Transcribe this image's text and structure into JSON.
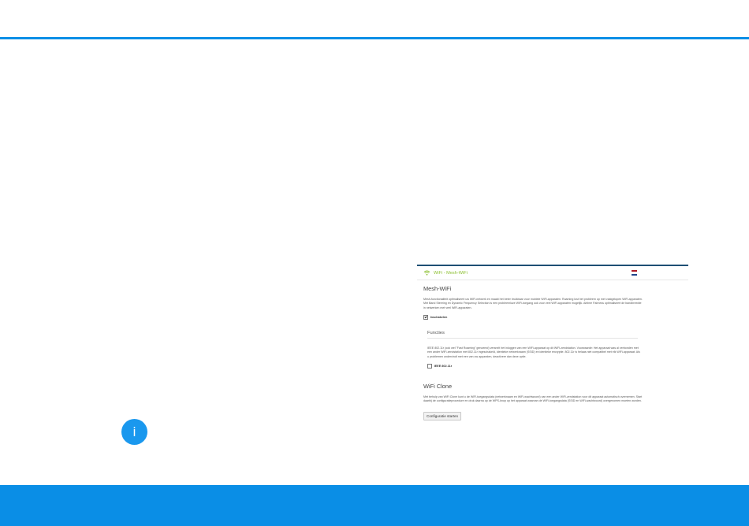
{
  "info_badge": {
    "icon": "info-icon",
    "glyph": "i"
  },
  "panel": {
    "breadcrumb": "WiFi - Mesh-WiFi",
    "mesh": {
      "title": "Mesh-WiFi",
      "text": "Mesh-functionaliteit optimaliseert uw WiFi-netwerk en maakt het beter bruikbaar voor mobiele WiFi-apparaten. Roaming lost het probleem op met vastgelopen WiFi-apparaten. Met Band Steering en Dynamic Frequency Selection is een probleemloze WiFi-toegang ook voor veel WiFi-apparaten mogelijk. Airtime Fairness optimaliseert de bandbreedte in netwerken met veel WiFi-apparaten.",
      "checkbox_label": "Inschakelen",
      "checked": true
    },
    "functions": {
      "title": "Functies",
      "text": "IEEE 802.11r (ook wel \"Fast Roaming\" genoemd) versnelt het inloggen van een WiFi-apparaat op dit WiFi-zendstation. Voorwaarde: Het apparaat was al verbonden met een ander WiFi-zendstation met 802.11r ingeschakeld, identieke netwerknaam (SSID) en identieke encryptie. 802.11r is helaas niet compatibel met elk WiFi-apparaat. Als u problemen ondervindt met een van uw apparaten, deactiveer dan deze optie.",
      "checkbox_label": "IEEE 802.11r",
      "checked": false
    },
    "clone": {
      "title": "WiFi Clone",
      "text": "Met behulp van WiFi Clone kunt u de WiFi-toegangsdata (netwerknaam en WiFi-wachtwoord) van een ander WiFi-zendstation voor dit apparaat automatisch overnemen. Start daarbij de configuratieprocedure en druk daarna op de WPS-knop op het apparaat waarvan de WiFi-toegangsdata (SSID en WiFi-wachtwoord) overgenomen moeten worden.",
      "button_label": "Configuratie starten"
    }
  },
  "colors": {
    "accent": "#0a8ee6",
    "panel_line": "#1e4f74",
    "breadcrumb": "#8bbf2f"
  }
}
